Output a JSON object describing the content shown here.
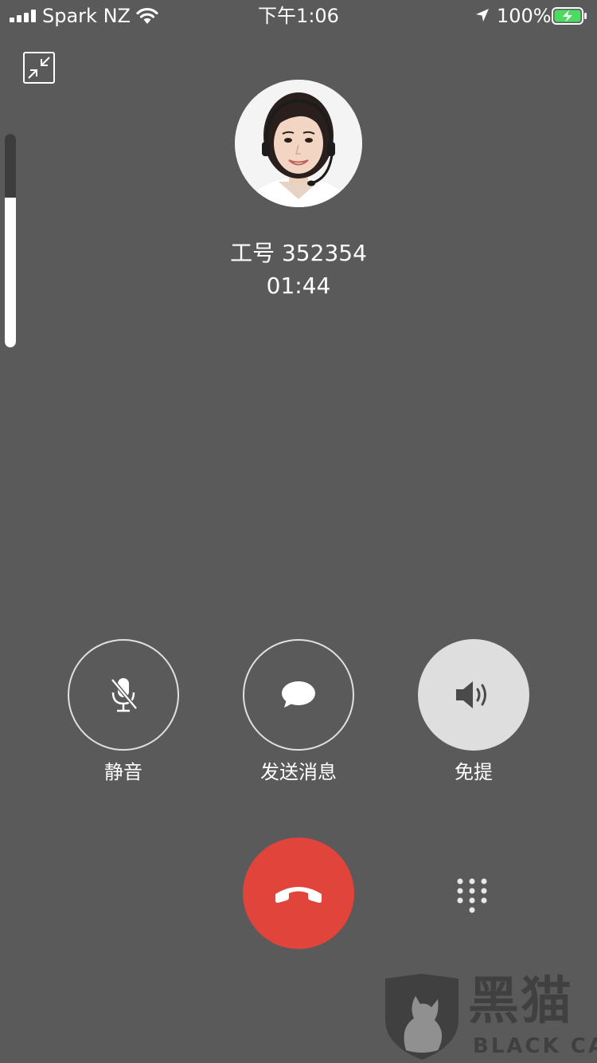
{
  "status_bar": {
    "carrier": "Spark NZ",
    "time": "下午1:06",
    "battery_percent": "100%",
    "battery_level": 1.0,
    "charging": true,
    "icons": [
      "signal-icon",
      "wifi-icon",
      "location-arrow-icon",
      "battery-charging-icon"
    ]
  },
  "call": {
    "caller": "工号 352354",
    "duration": "01:44",
    "volume_level": 0.7
  },
  "actions": {
    "mute_label": "静音",
    "message_label": "发送消息",
    "speaker_label": "免提",
    "speaker_active": true
  },
  "watermark": {
    "cn_text": "黑猫",
    "en_text": "BLACK CAT"
  },
  "colors": {
    "background": "#5a5a5a",
    "hangup": "#e0443a",
    "battery_fill": "#4cd964",
    "active_button": "#dedede"
  }
}
